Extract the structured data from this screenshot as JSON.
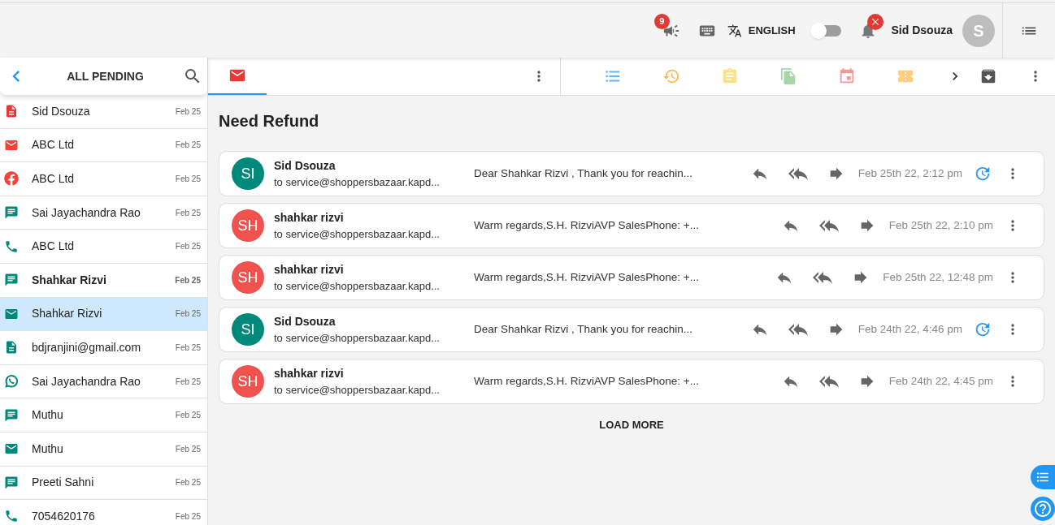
{
  "topbar": {
    "announcement_count": "9",
    "language": "ENGLISH",
    "toggle_on": false,
    "user_name": "Sid Dsouza",
    "user_initial": "S"
  },
  "sidebar": {
    "title": "ALL PENDING",
    "items": [
      {
        "kind": "document",
        "color": "#e53935",
        "name": "Sid Dsouza",
        "date": "Feb 25",
        "bold": false,
        "selected": false
      },
      {
        "kind": "mail",
        "color": "#f44336",
        "name": "ABC Ltd",
        "date": "Feb 25",
        "bold": false,
        "selected": false
      },
      {
        "kind": "facebook",
        "color": "#f44336",
        "name": "ABC Ltd",
        "date": "Feb 25",
        "bold": false,
        "selected": false
      },
      {
        "kind": "chat",
        "color": "#00897b",
        "name": "Sai Jayachandra Rao",
        "date": "Feb 25",
        "bold": false,
        "selected": false
      },
      {
        "kind": "phone",
        "color": "#00897b",
        "name": "ABC Ltd",
        "date": "Feb 25",
        "bold": false,
        "selected": false
      },
      {
        "kind": "chat",
        "color": "#00897b",
        "name": "Shahkar Rizvi",
        "date": "Feb 25",
        "bold": true,
        "selected": false
      },
      {
        "kind": "mail",
        "color": "#00897b",
        "name": "Shahkar Rizvi",
        "date": "Feb 25",
        "bold": false,
        "selected": true
      },
      {
        "kind": "document",
        "color": "#00897b",
        "name": "bdjranjini@gmail.com",
        "date": "Feb 25",
        "bold": false,
        "selected": false
      },
      {
        "kind": "whatsapp",
        "color": "#00897b",
        "name": "Sai Jayachandra Rao",
        "date": "Feb 25",
        "bold": false,
        "selected": false
      },
      {
        "kind": "chat",
        "color": "#00897b",
        "name": "Muthu",
        "date": "Feb 25",
        "bold": false,
        "selected": false
      },
      {
        "kind": "mail",
        "color": "#00897b",
        "name": "Muthu",
        "date": "Feb 25",
        "bold": false,
        "selected": false
      },
      {
        "kind": "chat",
        "color": "#00897b",
        "name": "Preeti Sahni",
        "date": "Feb 25",
        "bold": false,
        "selected": false
      },
      {
        "kind": "phone",
        "color": "#00897b",
        "name": "7054620176",
        "date": "Feb 25",
        "bold": false,
        "selected": false
      }
    ]
  },
  "conversation": {
    "title": "Need Refund",
    "load_more": "LOAD MORE",
    "messages": [
      {
        "initials": "SI",
        "color": "#00897b",
        "sender": "Sid Dsouza",
        "to": "to service@shoppersbazaar.kapd...",
        "preview": "Dear Shahkar Rizvi , Thank you for reachin...",
        "date": "Feb 25th 22, 2:12 pm",
        "followup": true
      },
      {
        "initials": "SH",
        "color": "#ef5350",
        "sender": "shahkar rizvi",
        "to": "to service@shoppersbazaar.kapd...",
        "preview": "Warm regards,S.H. RizviAVP SalesPhone: +...",
        "date": "Feb 25th 22, 2:10 pm",
        "followup": false
      },
      {
        "initials": "SH",
        "color": "#ef5350",
        "sender": "shahkar rizvi",
        "to": "to service@shoppersbazaar.kapd...",
        "preview": "Warm regards,S.H. RizviAVP SalesPhone: +...",
        "date": "Feb 25th 22, 12:48 pm",
        "followup": false
      },
      {
        "initials": "SI",
        "color": "#00897b",
        "sender": "Sid Dsouza",
        "to": "to service@shoppersbazaar.kapd...",
        "preview": "Dear Shahkar Rizvi , Thank you for reachin...",
        "date": "Feb 24th 22, 4:46 pm",
        "followup": true
      },
      {
        "initials": "SH",
        "color": "#ef5350",
        "sender": "shahkar rizvi",
        "to": "to service@shoppersbazaar.kapd...",
        "preview": "Warm regards,S.H. RizviAVP SalesPhone: +...",
        "date": "Feb 24th 22, 4:45 pm",
        "followup": false
      }
    ]
  }
}
